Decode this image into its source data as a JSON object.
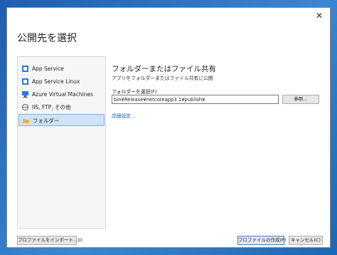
{
  "dialog": {
    "title": "公開先を選択"
  },
  "sidebar": {
    "items": [
      {
        "label": "App Service",
        "icon": "app-service-icon"
      },
      {
        "label": "App Service Linux",
        "icon": "app-service-linux-icon"
      },
      {
        "label": "Azure Virtual Machines",
        "icon": "virtual-machine-icon"
      },
      {
        "label": "IIS, FTP, その他",
        "icon": "globe-icon"
      },
      {
        "label": "フォルダー",
        "icon": "folder-icon",
        "selected": true
      }
    ]
  },
  "main": {
    "heading": "フォルダーまたはファイル共有",
    "subheading": "アプリをフォルダーまたはファイル共有に公開",
    "folder_label": "フォルダーを選択(F)",
    "folder_value": "bin¥Release¥netcoreapp3.1¥publish¥",
    "browse_label": "参照...",
    "advanced_link": "詳細設定..."
  },
  "footer": {
    "import_label": "プロファイルをインポート...(I)",
    "create_label": "プロファイルの作成(P)",
    "cancel_label": "キャンセル(C)"
  },
  "colors": {
    "accent": "#1a5fb4",
    "selection": "#cde3f7",
    "desktop": "#2f72b8"
  }
}
